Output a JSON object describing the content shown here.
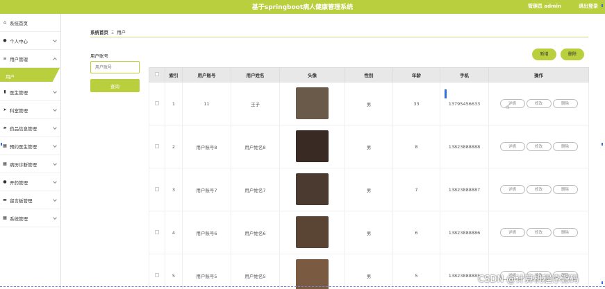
{
  "header": {
    "title": "基于springboot病人健康管理系统",
    "user": "管理员 admin",
    "logout": "退出登录"
  },
  "sidebar": {
    "items": [
      {
        "label": "系统首页",
        "icon": "home-icon",
        "chevron": false
      },
      {
        "label": "个人中心",
        "icon": "person-icon",
        "chevron": true
      },
      {
        "label": "用户管理",
        "icon": "list-icon",
        "chevron": true,
        "expanded": true
      },
      {
        "label": "医生管理",
        "icon": "doc-icon",
        "chevron": true
      },
      {
        "label": "科室管理",
        "icon": "send-icon",
        "chevron": true
      },
      {
        "label": "药品信息管理",
        "icon": "pill-icon",
        "chevron": true
      },
      {
        "label": "预约医生管理",
        "icon": "grid-icon",
        "chevron": true
      },
      {
        "label": "病历诊断管理",
        "icon": "grid-icon",
        "chevron": true
      },
      {
        "label": "开药管理",
        "icon": "user-icon",
        "chevron": true
      },
      {
        "label": "留言板管理",
        "icon": "board-icon",
        "chevron": true
      },
      {
        "label": "系统管理",
        "icon": "grid-icon",
        "chevron": true
      }
    ],
    "submenu_active": "用户"
  },
  "breadcrumb": {
    "home": "系统首页",
    "separator": "Ξ",
    "current": "用户"
  },
  "filter": {
    "label": "用户账号",
    "placeholder": "用户账号",
    "search_label": "查询"
  },
  "toolbar": {
    "add_label": "新增",
    "delete_label": "删除"
  },
  "table": {
    "columns": [
      "索引",
      "用户账号",
      "用户姓名",
      "头像",
      "性别",
      "年龄",
      "手机",
      "操作"
    ],
    "rows": [
      {
        "index": "1",
        "account": "11",
        "name": "王子",
        "gender": "男",
        "age": "33",
        "phone": "13795456633",
        "avatar_color": "#6a5a4a"
      },
      {
        "index": "2",
        "account": "用户账号8",
        "name": "用户姓名8",
        "gender": "男",
        "age": "8",
        "phone": "13823888888",
        "avatar_color": "#3a2a24"
      },
      {
        "index": "3",
        "account": "用户账号7",
        "name": "用户姓名7",
        "gender": "男",
        "age": "7",
        "phone": "13823888887",
        "avatar_color": "#4a3a30"
      },
      {
        "index": "4",
        "account": "用户账号6",
        "name": "用户姓名6",
        "gender": "男",
        "age": "6",
        "phone": "13823888886",
        "avatar_color": "#5a4434"
      },
      {
        "index": "5",
        "account": "用户账号5",
        "name": "用户姓名5",
        "gender": "男",
        "age": "5",
        "phone": "13823888885",
        "avatar_color": "#7a5a40"
      }
    ],
    "actions": {
      "detail": "详情",
      "edit": "修改",
      "delete": "删除"
    }
  },
  "watermark": "CSDN @计算机程序源码",
  "colors": {
    "accent": "#b9cf3d",
    "header_bg": "#b9cf3d",
    "table_header_bg": "#e8e8e8"
  }
}
